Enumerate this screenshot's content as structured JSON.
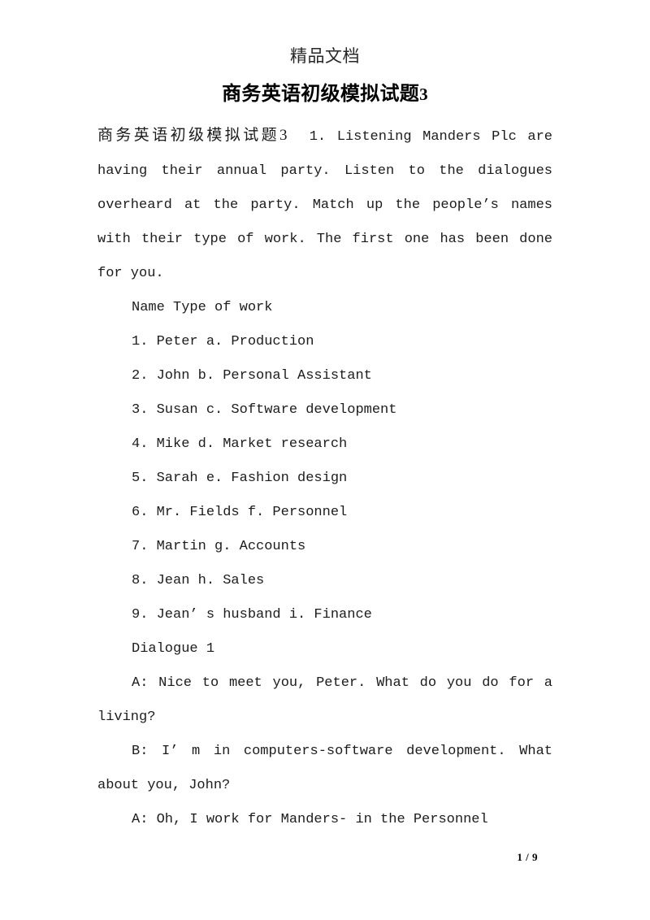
{
  "document": {
    "running_header": "精品文档",
    "title_text": "商务英语初级模拟试题",
    "title_number": "3",
    "page_indicator": "1 / 9"
  },
  "content": {
    "intro_cjk": "商务英语初级模拟试题3",
    "intro_en": "1. Listening Manders Plc are having their annual party. Listen to the dialogues overheard at the party. Match up the people’s names with their type of work. The first one has been done for you.",
    "table_header": "Name Type of work",
    "match_items": [
      "1. Peter a. Production",
      "2. John b. Personal Assistant",
      "3. Susan c. Software development",
      "4. Mike d. Market research",
      "5. Sarah e. Fashion design",
      "6. Mr. Fields f. Personnel",
      "7. Martin g. Accounts",
      "8. Jean h. Sales",
      "9. Jean’ s husband i. Finance"
    ],
    "dialogue_heading": "Dialogue 1",
    "dialogue_lines": [
      "A: Nice to meet you, Peter. What do you do for a living?",
      "B: I’ m in computers-software development. What about you, John?",
      "A: Oh, I work for Manders- in the Personnel"
    ]
  },
  "colors": {
    "page_background": "#ffffff",
    "body_text": "#1c1c1c",
    "title_text": "#000000"
  }
}
